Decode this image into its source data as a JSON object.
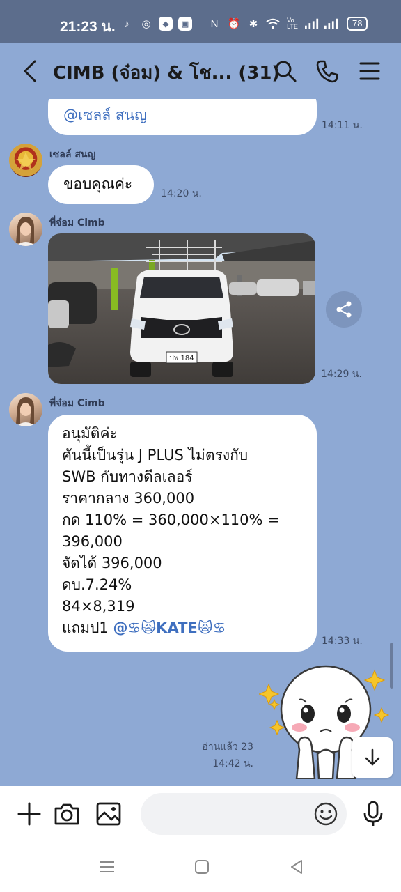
{
  "status_bar": {
    "time": "21:23 น.",
    "battery": "78"
  },
  "header": {
    "title": "CIMB (จ๋อม) & โช...",
    "member_count": "(31)"
  },
  "messages": [
    {
      "type": "text",
      "mention": "@เซลล์ สนญ",
      "time": "14:11 น."
    },
    {
      "type": "text",
      "sender": "เซลล์ สนญ",
      "text": "ขอบคุณค่ะ",
      "time": "14:20 น."
    },
    {
      "type": "image",
      "sender": "พี่จ๋อม Cimb",
      "plate_text": "ปพ 184",
      "time": "14:29 น."
    },
    {
      "type": "text",
      "sender": "พี่จ๋อม Cimb",
      "lines": [
        "อนุมัติค่ะ",
        "คันนี้เป็นรุ่น J PLUS ไม่ตรงกับ",
        "SWB กับทางดีลเลอร์",
        "ราคากลาง 360,000",
        "กด 110% = 360,000×110% =",
        "396,000",
        "จัดได้ 396,000",
        "ดบ.7.24%",
        "84×8,319"
      ],
      "last_line_prefix": "แถมป1 ",
      "last_line_mention": "@♋🙀KATE🙀♋",
      "time": "14:33 น."
    },
    {
      "type": "sticker",
      "read_label": "อ่านแล้ว 23",
      "time": "14:42 น."
    }
  ],
  "input": {
    "placeholder": ""
  },
  "colors": {
    "chat_background": "#8ea9d4",
    "status_bar": "#5c6d8c",
    "mention": "#3f6fbf"
  },
  "icons": {
    "back": "chevron-left-icon",
    "search": "search-icon",
    "call": "phone-icon",
    "menu": "hamburger-menu-icon",
    "share": "share-icon",
    "scroll_down": "arrow-down-icon",
    "add": "plus-icon",
    "camera": "camera-icon",
    "gallery": "image-icon",
    "emoji": "smiley-icon",
    "voice": "microphone-icon"
  }
}
